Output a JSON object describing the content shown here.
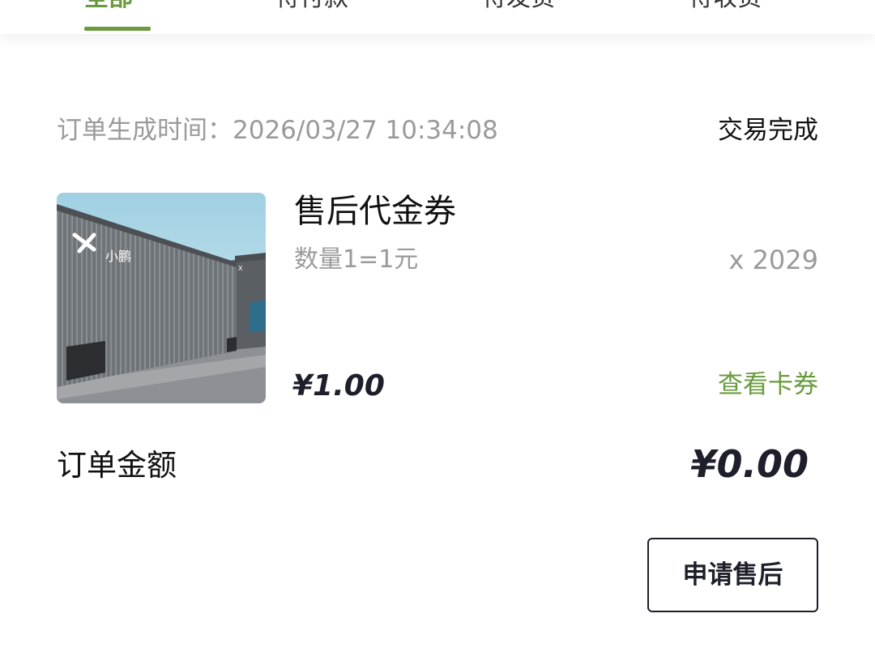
{
  "tabs": [
    {
      "label": "全部",
      "active": true
    },
    {
      "label": "待付款",
      "active": false
    },
    {
      "label": "待发货",
      "active": false
    },
    {
      "label": "待收货",
      "active": false
    }
  ],
  "order": {
    "time_text": "订单生成时间：2026/03/27 10:34:08",
    "status": "交易完成",
    "item": {
      "name": "售后代金券",
      "spec": "数量1=1元",
      "quantity": "x 2029",
      "price": "¥1.00",
      "view_coupon_label": "查看卡券",
      "image_logo_text": "小鹏"
    },
    "amount_label": "订单金额",
    "amount_value": "¥0.00",
    "aftersale_button_label": "申请售后"
  },
  "colors": {
    "accent_green": "#6a9a3f",
    "text_dark": "#1d1f2a",
    "text_gray": "#9a9a9a"
  }
}
